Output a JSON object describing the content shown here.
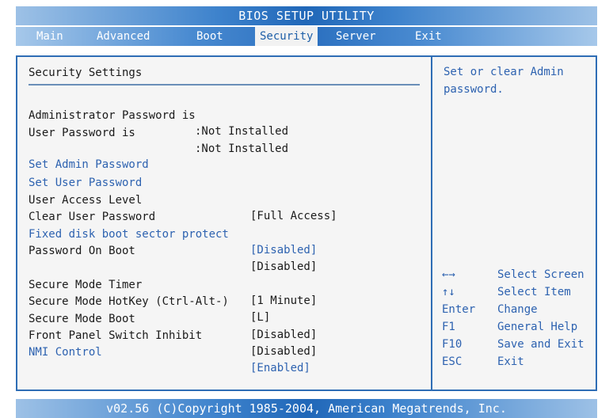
{
  "title": "BIOS SETUP UTILITY",
  "tabs": [
    {
      "label": "Main"
    },
    {
      "label": "Advanced"
    },
    {
      "label": "Boot"
    },
    {
      "label": "Security"
    },
    {
      "label": "Server"
    },
    {
      "label": "Exit"
    }
  ],
  "active_tab": "Security",
  "section_title": "Security Settings",
  "status": [
    {
      "label": "Administrator Password is",
      "value": ":Not Installed"
    },
    {
      "label": "User Password is",
      "value": ":Not Installed"
    }
  ],
  "items": [
    {
      "label": "Set Admin Password",
      "value": "",
      "selectable": true
    },
    {
      "label": "Set User Password",
      "value": "",
      "selectable": true
    },
    {
      "label": "User Access Level",
      "value": "[Full Access]",
      "selectable": false
    },
    {
      "label": "Clear User Password",
      "value": "",
      "selectable": false
    },
    {
      "label": "Fixed disk boot sector protect",
      "value": "[Disabled]",
      "selectable": true
    },
    {
      "label": "Password On Boot",
      "value": "[Disabled]",
      "selectable": false
    },
    {
      "label": "Secure Mode Timer",
      "value": "[1 Minute]",
      "selectable": false
    },
    {
      "label": "Secure Mode HotKey (Ctrl-Alt-)",
      "value": "[L]",
      "selectable": false
    },
    {
      "label": "Secure Mode Boot",
      "value": "[Disabled]",
      "selectable": false
    },
    {
      "label": "Front Panel Switch Inhibit",
      "value": "[Disabled]",
      "selectable": false
    },
    {
      "label": "NMI Control",
      "value": "[Enabled]",
      "selectable": true
    }
  ],
  "help": {
    "text": "Set or clear Admin password.",
    "keys": [
      {
        "key": "←→",
        "desc": "Select Screen"
      },
      {
        "key": "↑↓",
        "desc": "Select Item"
      },
      {
        "key": "Enter",
        "desc": "Change"
      },
      {
        "key": "F1",
        "desc": "General Help"
      },
      {
        "key": "F10",
        "desc": "Save and Exit"
      },
      {
        "key": "ESC",
        "desc": "Exit"
      }
    ]
  },
  "footer": "v02.56 (C)Copyright 1985-2004, American Megatrends, Inc.",
  "colors": {
    "accent": "#2e6db5",
    "selectable_text": "#2d62b0",
    "panel_bg": "#f5f5f5"
  }
}
